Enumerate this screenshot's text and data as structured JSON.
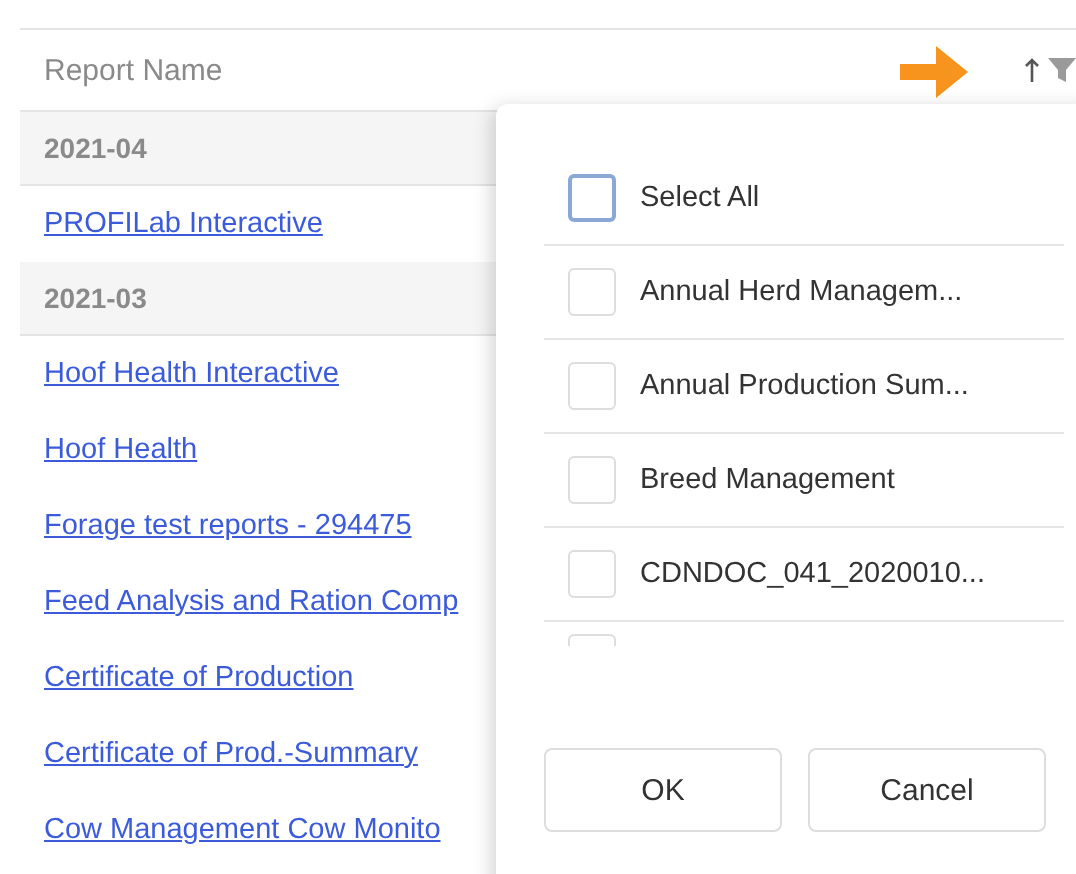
{
  "table": {
    "column": {
      "label": "Report Name",
      "sorted_ascending": true
    },
    "groups": [
      {
        "label": "2021-04",
        "rows": [
          "PROFILab Interactive"
        ]
      },
      {
        "label": "2021-03",
        "rows": [
          "Hoof Health Interactive",
          "Hoof Health",
          "Forage test reports - 294475",
          "Feed Analysis and Ration Comp",
          "Certificate of Production",
          "Certificate of Prod.-Summary",
          "Cow Management Cow Monito"
        ]
      }
    ]
  },
  "filter_popup": {
    "options": [
      {
        "label": "Select All",
        "checked": false,
        "focused": true
      },
      {
        "label": "Annual Herd Managem...",
        "checked": false,
        "focused": false
      },
      {
        "label": "Annual Production Sum...",
        "checked": false,
        "focused": false
      },
      {
        "label": "Breed Management",
        "checked": false,
        "focused": false
      },
      {
        "label": "CDNDOC_041_2020010...",
        "checked": false,
        "focused": false
      }
    ],
    "cut_off_option": {
      "checked": false
    },
    "buttons": [
      "OK",
      "Cancel"
    ]
  }
}
